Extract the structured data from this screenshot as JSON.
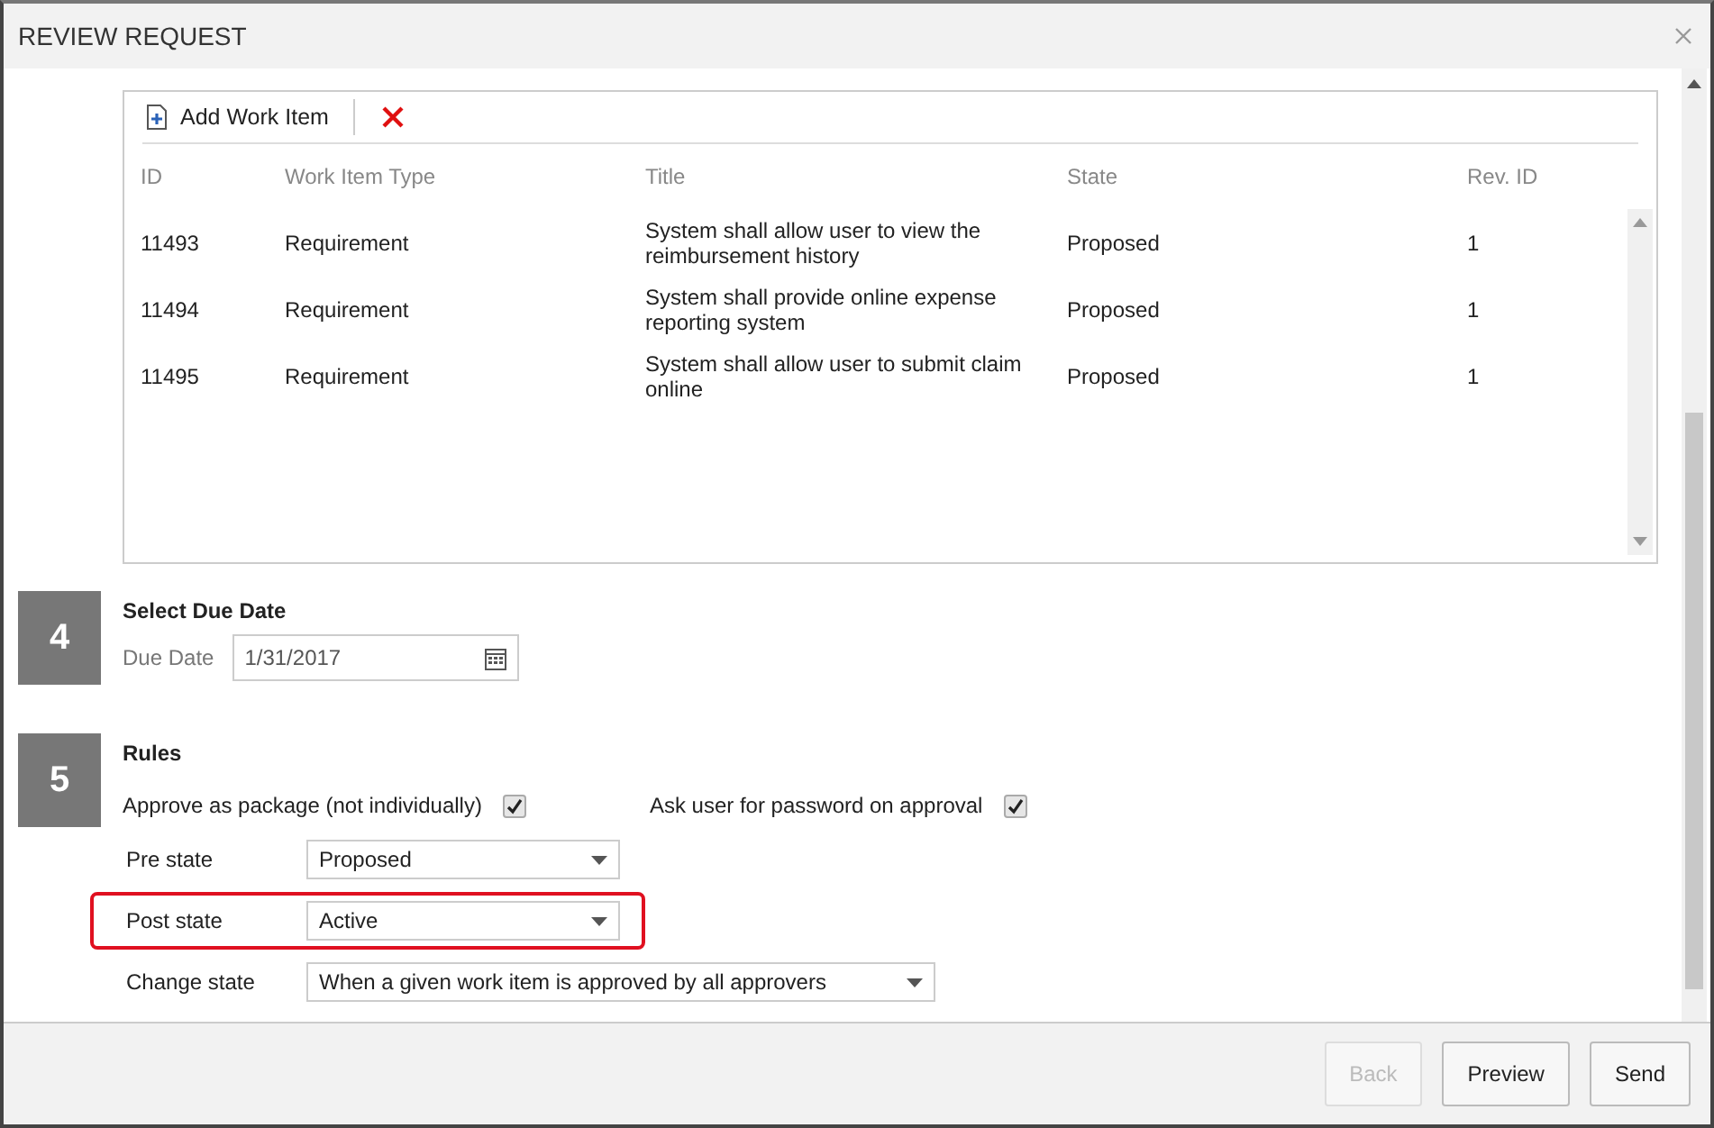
{
  "window": {
    "title": "REVIEW REQUEST"
  },
  "toolbar": {
    "add_label": "Add Work Item"
  },
  "table": {
    "columns": [
      "ID",
      "Work Item Type",
      "Title",
      "State",
      "Rev. ID"
    ],
    "rows": [
      {
        "id": "11493",
        "type": "Requirement",
        "title": "System shall allow user to view the reimbursement history",
        "state": "Proposed",
        "rev": "1"
      },
      {
        "id": "11494",
        "type": "Requirement",
        "title": "System shall provide online expense reporting system",
        "state": "Proposed",
        "rev": "1"
      },
      {
        "id": "11495",
        "type": "Requirement",
        "title": "System shall allow user to submit claim online",
        "state": "Proposed",
        "rev": "1"
      }
    ]
  },
  "due_section": {
    "number": "4",
    "title": "Select Due Date",
    "label": "Due Date",
    "value": "1/31/2017"
  },
  "rules_section": {
    "number": "5",
    "title": "Rules",
    "checks": [
      {
        "label": "Approve as package (not individually)",
        "checked": true
      },
      {
        "label": "Ask user for password on approval",
        "checked": true
      }
    ],
    "fields": [
      {
        "label": "Pre state",
        "value": "Proposed",
        "highlighted": false,
        "wide": false
      },
      {
        "label": "Post state",
        "value": "Active",
        "highlighted": true,
        "wide": false
      },
      {
        "label": "Change state",
        "value": "When a given work item is approved by all approvers",
        "highlighted": false,
        "wide": true
      }
    ]
  },
  "buttons": [
    {
      "label": "Back",
      "disabled": true
    },
    {
      "label": "Preview",
      "disabled": false
    },
    {
      "label": "Send",
      "disabled": false
    }
  ]
}
